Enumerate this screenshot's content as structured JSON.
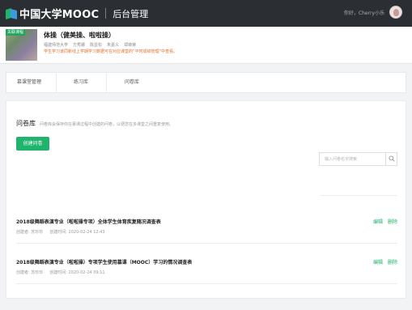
{
  "header": {
    "brand": "中国大学MOOC",
    "subtitle": "后台管理",
    "greeting": "你好，Cherry小乐"
  },
  "course": {
    "tag": "关联课程",
    "title": "体操（健美操、啦啦操）",
    "meta": [
      "福建师范大学",
      "方秀娜",
      "陈显松",
      "朱嘉义",
      "郑锋荣"
    ],
    "note": "学生学习该同新线上学期学习数据可在对应课堂的“平时成绩管理”中查看。"
  },
  "tabs": [
    "慕课堂管理",
    "练习库",
    "问卷库"
  ],
  "section": {
    "title": "问卷库",
    "desc": "问卷库会保存你在慕课过程中创建的问卷，以便您在多课堂之间重复使用。",
    "create_label": "创建问卷",
    "search_placeholder": "输入问卷名字搜索"
  },
  "questionnaires": [
    {
      "title": "2018级舞蹈表演专业（啦啦操专项）全体学生体育疾复随况调查表",
      "creator": "创建者: 苏珍珍",
      "time": "创建时间: 2020-02-24 12:43",
      "edit": "编辑",
      "delete": "删除"
    },
    {
      "title": "2018级舞蹈表演专业（啦啦操）专项学生使用慕课（MOOC）学习的情况调查表",
      "creator": "创建者: 苏珍珍",
      "time": "创建时间: 2020-02-24 09:11",
      "edit": "编辑",
      "delete": "删除"
    }
  ],
  "colors": {
    "topbar": "#2b2f33",
    "accent": "#1fb36b",
    "note": "#e0702e"
  },
  "icons": [
    "mooc-logo-icon",
    "search-icon",
    "avatar"
  ]
}
